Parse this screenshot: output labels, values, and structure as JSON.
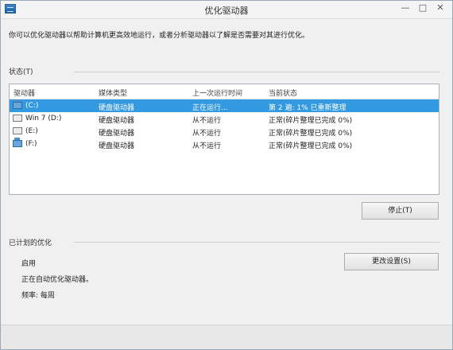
{
  "window": {
    "title": "优化驱动器",
    "minimize": "—",
    "maximize": "□",
    "close": "✕"
  },
  "intro": "你可以优化驱动器以帮助计算机更高效地运行，或者分析驱动器以了解是否需要对其进行优化。",
  "status": {
    "label": "状态(T)",
    "columns": [
      "驱动器",
      "媒体类型",
      "上一次运行时间",
      "当前状态"
    ],
    "rows": [
      {
        "drive": "(C:)",
        "icon": "system-drive-icon",
        "media": "硬盘驱动器",
        "last_run": "正在运行...",
        "state": "第 2 遍: 1% 已重新整理",
        "selected": true
      },
      {
        "drive": "Win 7 (D:)",
        "icon": "hard-drive-icon",
        "media": "硬盘驱动器",
        "last_run": "从不运行",
        "state": "正常(碎片整理已完成 0%)",
        "selected": false
      },
      {
        "drive": "(E:)",
        "icon": "hard-drive-icon",
        "media": "硬盘驱动器",
        "last_run": "从不运行",
        "state": "正常(碎片整理已完成 0%)",
        "selected": false
      },
      {
        "drive": "(F:)",
        "icon": "system-drive-icon",
        "media": "硬盘驱动器",
        "last_run": "从不运行",
        "state": "正常(碎片整理已完成 0%)",
        "selected": false
      }
    ],
    "stop_button": "停止(T)"
  },
  "scheduled": {
    "label": "已计划的优化",
    "state": "启用",
    "description": "正在自动优化驱动器。",
    "frequency": "频率: 每周",
    "change_button": "更改设置(S)"
  }
}
